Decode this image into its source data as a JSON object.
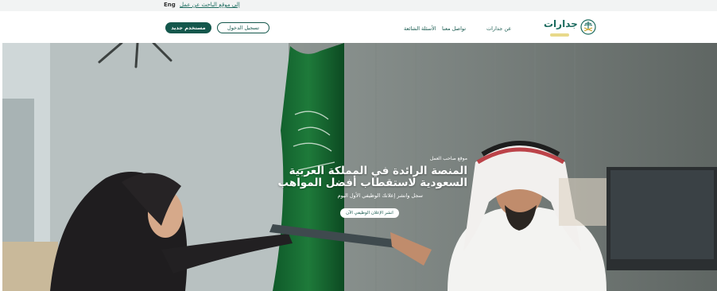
{
  "topbar": {
    "lang_label": "Eng",
    "seeker_link": "إلى موقع الباحث عن عمل"
  },
  "nav": {
    "new_user": "مستخدم جديد",
    "login": "تسجيل الدخول",
    "faq": "الأسئلة الشائعة",
    "contact": "تواصل معنا",
    "about": "عن جدارات"
  },
  "logo": {
    "brand": "جدارات"
  },
  "hero": {
    "kicker": "موقع صاحب العمل",
    "headline_line1": "المنصة الرائدة في المملكة العربية",
    "headline_line2": "السعودية لاستقطاب أفضل المواهب",
    "description": "سجل وانشر إعلانك الوظيفي الأول اليوم",
    "cta": "انشر الإعلان الوظيفي الآن"
  },
  "colors": {
    "primary": "#14574c",
    "accent": "#1b6b5e"
  }
}
